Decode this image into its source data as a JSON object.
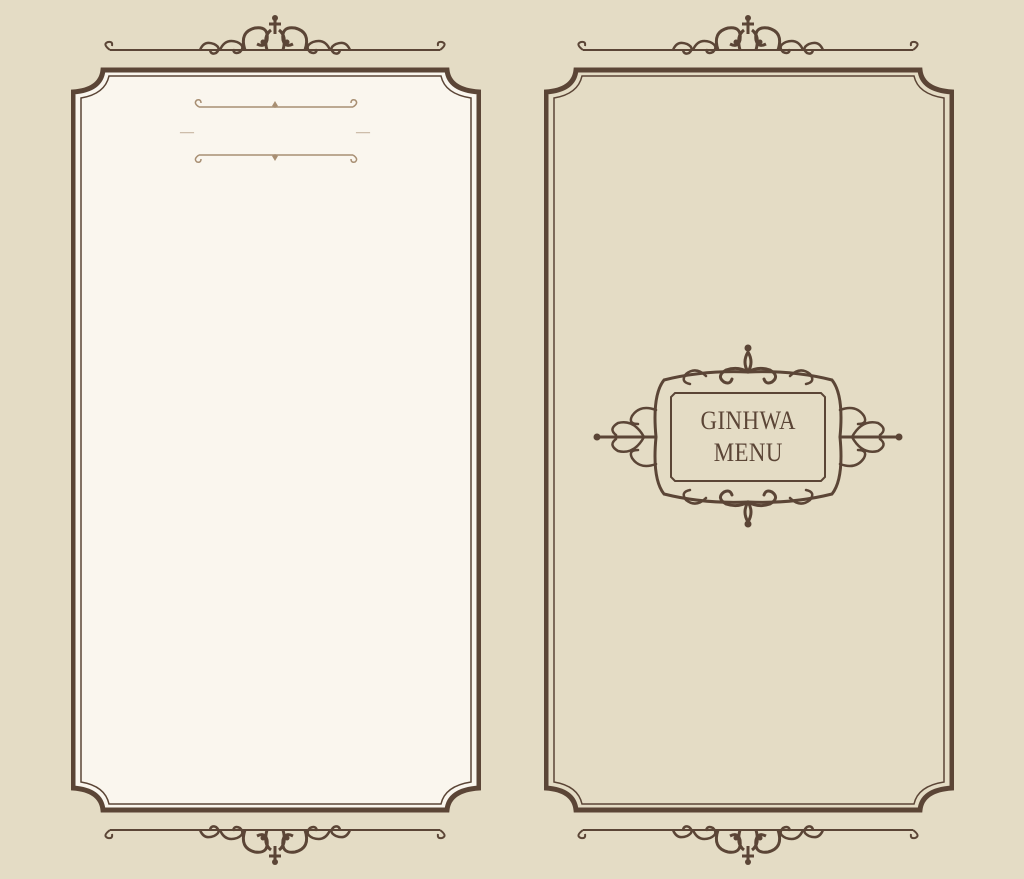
{
  "colors": {
    "background": "#e4dcc5",
    "frame": "#5b4536",
    "inner_page": "#faf6ee",
    "ornament_light": "#a88f73"
  },
  "cover": {
    "title_line1": "GINHWA",
    "title_line2": "MENU"
  },
  "inside_page": {
    "heading_placeholder_left": "—",
    "heading_placeholder_right": "—"
  },
  "icons": [
    "top-scroll-ornament-icon",
    "bottom-scroll-ornament-icon",
    "crest-cartouche-icon",
    "heading-flourish-icon"
  ]
}
